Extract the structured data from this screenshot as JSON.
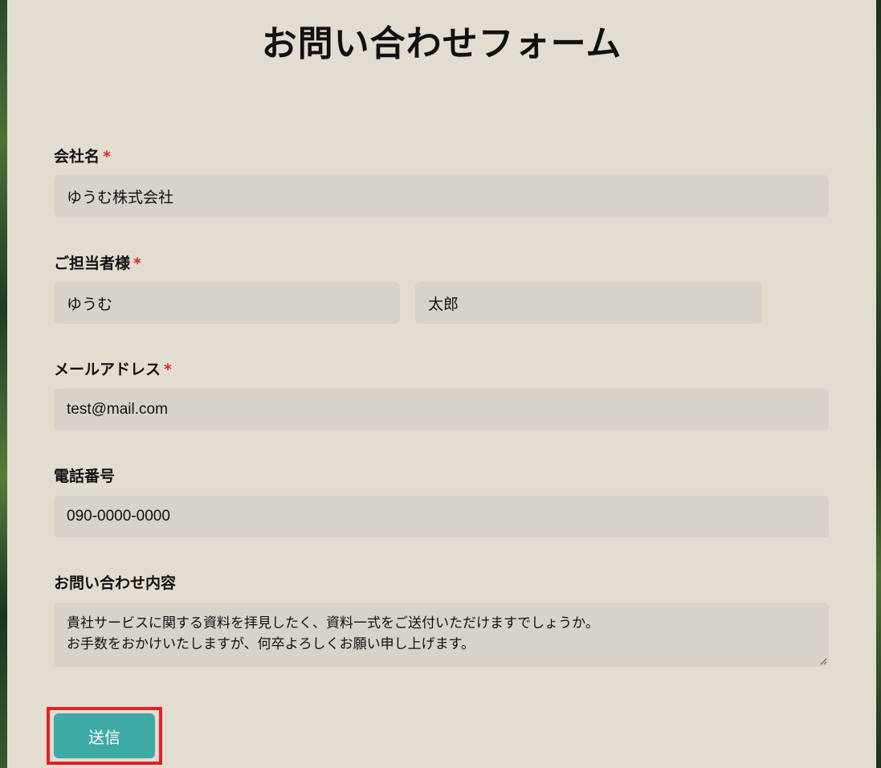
{
  "form": {
    "title": "お問い合わせフォーム",
    "required_mark": "*",
    "company": {
      "label": "会社名",
      "value": "ゆうむ株式会社"
    },
    "contact_person": {
      "label": "ご担当者様",
      "last_name": "ゆうむ",
      "first_name": "太郎"
    },
    "email": {
      "label": "メールアドレス",
      "value": "test@mail.com"
    },
    "phone": {
      "label": "電話番号",
      "value": "090-0000-0000"
    },
    "message": {
      "label": "お問い合わせ内容",
      "lines": [
        "貴社サービスに関する資料を拝見したく、資料一式をご送付いただけますでしょうか。",
        "お手数をおかけいたしますが、何卒よろしくお願い申し上げます。"
      ]
    },
    "submit_label": "送信"
  },
  "colors": {
    "panel_background": "#e3ddd1",
    "field_background": "#d7d2ca",
    "required_mark": "#d62828",
    "submit_button": "#3daaa6",
    "highlight_border": "#e0202a"
  }
}
